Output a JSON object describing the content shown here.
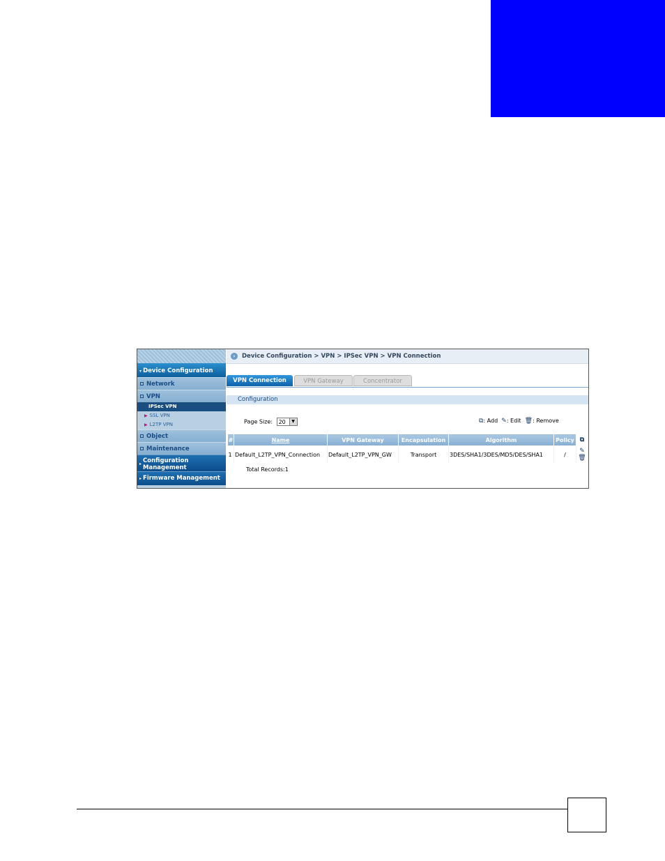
{
  "sidebar": {
    "header": "Device Configuration",
    "items": [
      "Network",
      "VPN"
    ],
    "vpn_sub": {
      "active": "IPSec VPN",
      "others": [
        "SSL VPN",
        "L2TP VPN"
      ]
    },
    "items_after": [
      "Object",
      "Maintenance"
    ],
    "config_mgmt": "Configuration Management",
    "firmware_mgmt": "Firmware Management"
  },
  "breadcrumb": "Device Configuration > VPN > IPSec VPN > VPN Connection",
  "tabs": [
    "VPN Connection",
    "VPN Gateway",
    "Concentrator"
  ],
  "section_title": "Configuration",
  "page_size": {
    "label": "Page Size:",
    "value": "20"
  },
  "legend": {
    "add": ": Add",
    "edit": ": Edit",
    "remove": ": Remove"
  },
  "table": {
    "headers": [
      "#",
      "Name",
      "VPN Gateway",
      "Encapsulation",
      "Algorithm",
      "Policy"
    ],
    "rows": [
      [
        "1",
        "Default_L2TP_VPN_Connection",
        "Default_L2TP_VPN_GW",
        "Transport",
        "3DES/SHA1/3DES/MD5/DES/SHA1",
        "/"
      ]
    ]
  },
  "total_records": "Total Records:1",
  "colors": {
    "chapter_tab": "#0000ff",
    "sidebar_header": "#0e5e9c",
    "active_tab": "#0e63a8"
  }
}
